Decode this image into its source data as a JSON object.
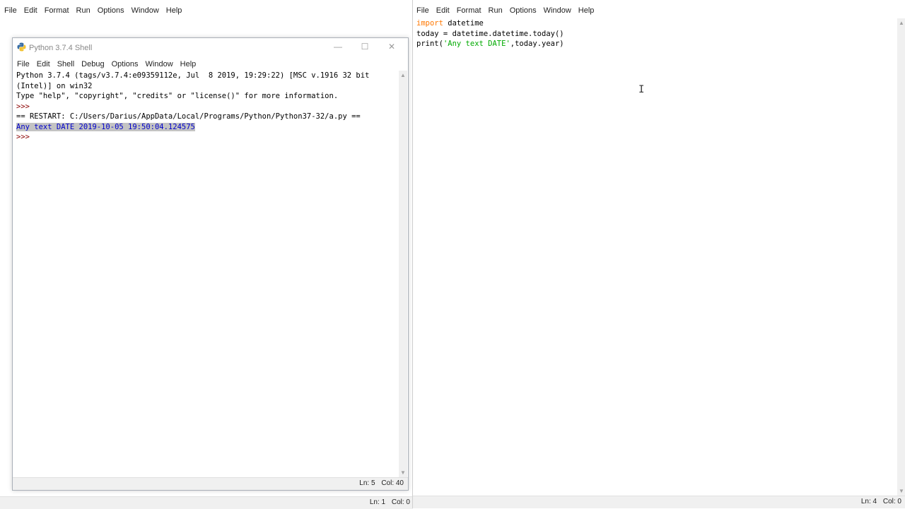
{
  "background_window": {
    "menu": [
      "File",
      "Edit",
      "Format",
      "Run",
      "Options",
      "Window",
      "Help"
    ],
    "status": {
      "ln": "Ln: 1",
      "col": "Col: 0"
    }
  },
  "shell": {
    "title": "Python 3.7.4 Shell",
    "menu": [
      "File",
      "Edit",
      "Shell",
      "Debug",
      "Options",
      "Window",
      "Help"
    ],
    "lines": [
      "Python 3.7.4 (tags/v3.7.4:e09359112e, Jul  8 2019, 19:29:22) [MSC v.1916 32 bit",
      "(Intel)] on win32",
      "Type \"help\", \"copyright\", \"credits\" or \"license()\" for more information.",
      ">>> ",
      "== RESTART: C:/Users/Darius/AppData/Local/Programs/Python/Python37-32/a.py ==",
      "Any text DATE 2019-10-05 19:50:04.124575",
      ">>> "
    ],
    "status": {
      "ln": "Ln: 5",
      "col": "Col: 40"
    },
    "controls": {
      "minimize": "—",
      "maximize": "☐",
      "close": "✕"
    }
  },
  "editor": {
    "menu": [
      "File",
      "Edit",
      "Format",
      "Run",
      "Options",
      "Window",
      "Help"
    ],
    "code": {
      "line1_kw": "import",
      "line1_rest": " datetime",
      "line2": "today = datetime.datetime.today()",
      "line3_pre": "print(",
      "line3_str": "'Any text DATE'",
      "line3_post": ",today.year)"
    },
    "status": {
      "ln": "Ln: 4",
      "col": "Col: 0"
    }
  },
  "icons": {
    "cursor": "text-cursor-ibeam-icon",
    "shell_icon": "python-icon"
  },
  "colors": {
    "keyword": "#ff7700",
    "string": "#00aa00",
    "prompt": "#8b0000",
    "output": "#0000cc",
    "selection": "#c3c3c3"
  }
}
